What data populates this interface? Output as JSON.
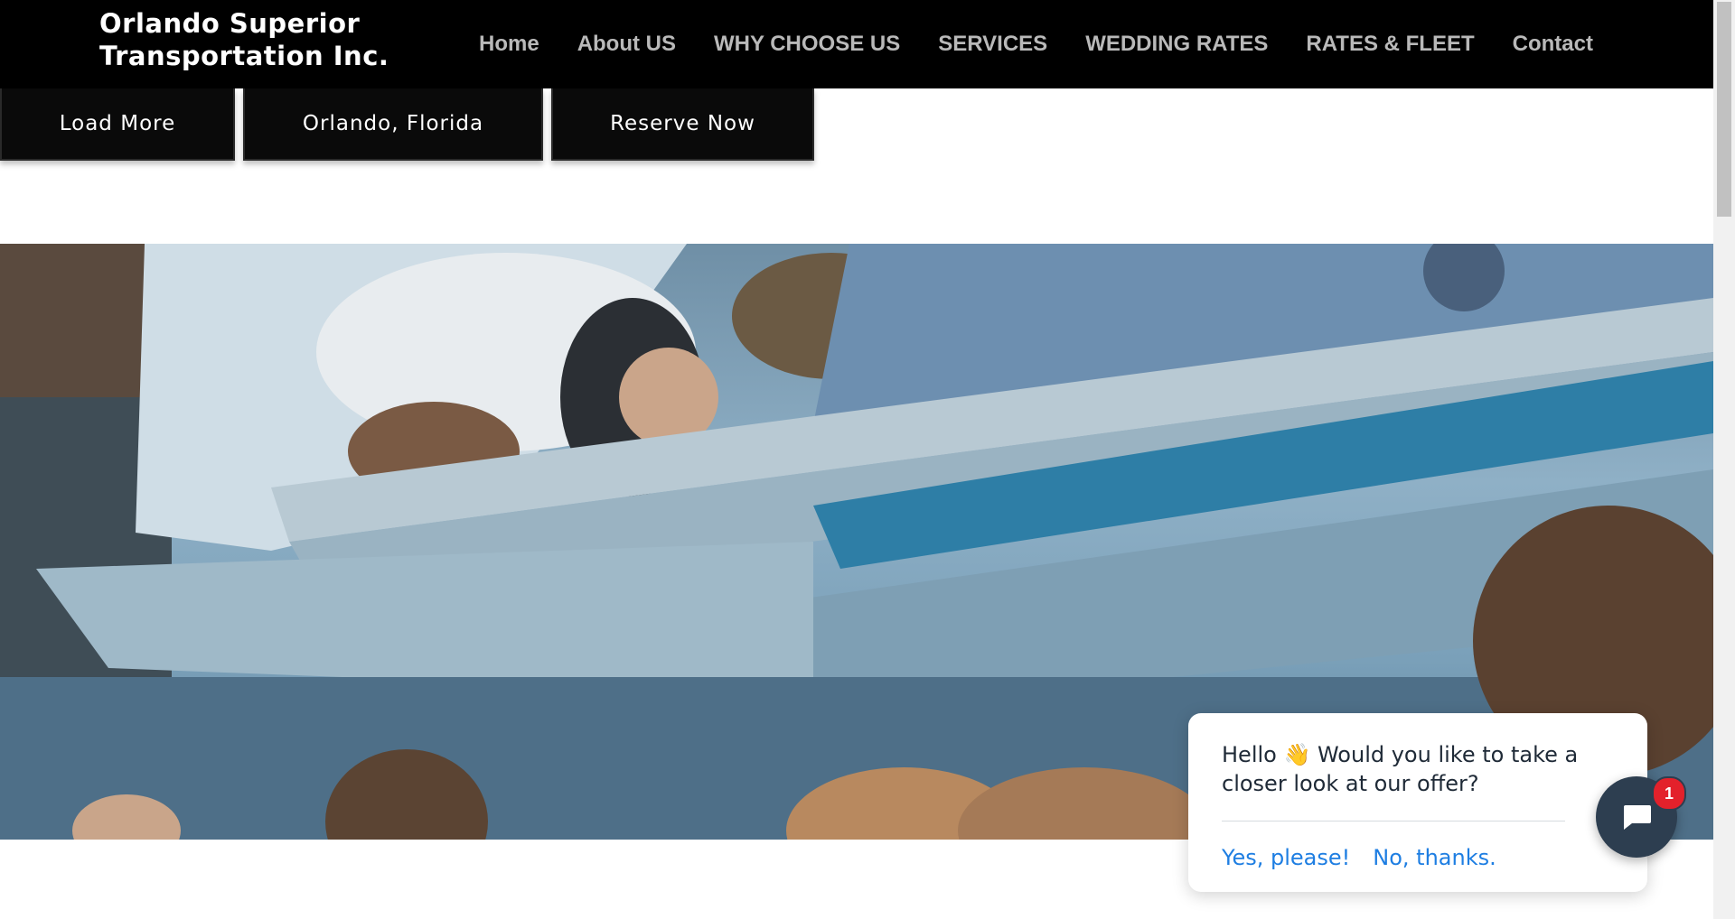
{
  "header": {
    "brand_line1": "Orlando Superior",
    "brand_line2": "Transportation Inc.",
    "nav": [
      "Home",
      "About US",
      "WHY CHOOSE US",
      "SERVICES",
      "WEDDING RATES",
      "RATES & FLEET",
      "Contact"
    ]
  },
  "actions": {
    "load_more": "Load More",
    "location": "Orlando, Florida",
    "reserve": "Reserve Now"
  },
  "chat": {
    "message": "Hello 👋 Would you like to take a closer look at our offer?",
    "yes": "Yes, please!",
    "no": "No, thanks.",
    "badge_count": "1"
  },
  "colors": {
    "header_bg": "#000000",
    "nav_text": "#b9b9b9",
    "chat_link": "#1e7ee2",
    "launcher": "#2d3e50",
    "badge": "#e3212b"
  }
}
